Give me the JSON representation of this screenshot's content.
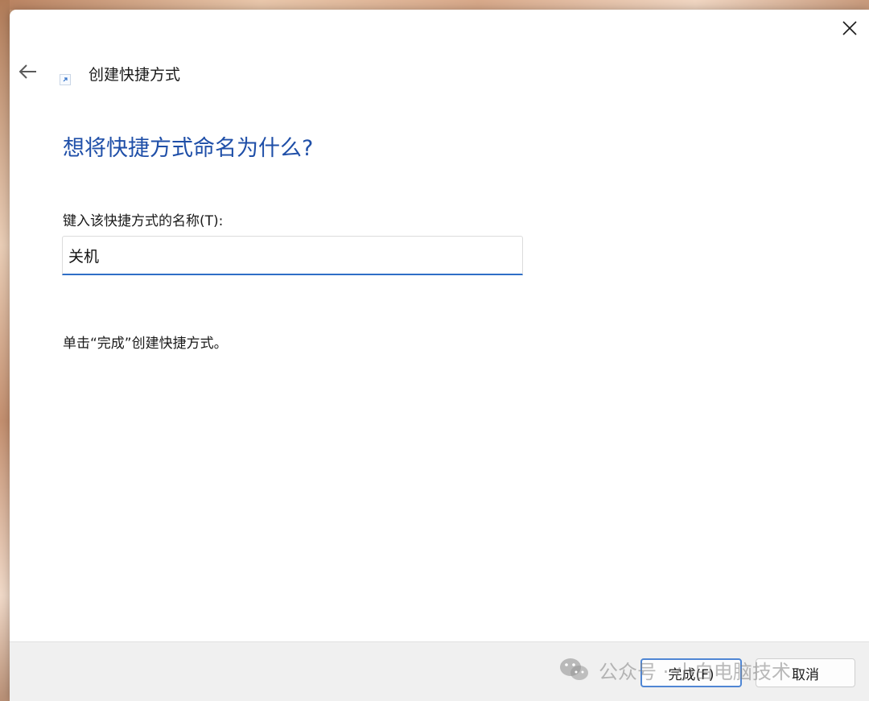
{
  "window": {
    "title": "创建快捷方式"
  },
  "main": {
    "heading": "想将快捷方式命名为什么?",
    "field_label": "键入该快捷方式的名称(T):",
    "name_value": "关机",
    "hint": "单击“完成”创建快捷方式。"
  },
  "footer": {
    "finish_label": "完成(F)",
    "cancel_label": "取消"
  },
  "watermark": {
    "text": "公众号 · 小白电脑技术"
  },
  "colors": {
    "heading": "#1f4fa8",
    "input_focus": "#2f6fc7",
    "default_button_border": "#4f86d4"
  },
  "icons": {
    "back": "arrow-left",
    "close": "x",
    "shortcut": "shortcut-arrow",
    "watermark": "wechat"
  }
}
